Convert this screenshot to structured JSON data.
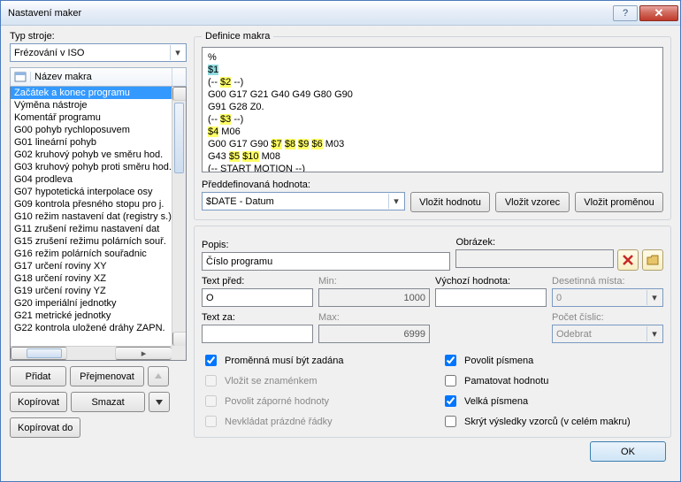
{
  "window": {
    "title": "Nastavení maker"
  },
  "left": {
    "machine_label": "Typ stroje:",
    "machine_value": "Frézování v ISO",
    "col_name": "Název makra",
    "items": [
      "Začátek a konec programu",
      "Výměna nástroje",
      "Komentář programu",
      "G00 pohyb rychloposuvem",
      "G01 lineární pohyb",
      "G02 kruhový pohyb ve směru hod.",
      "G03 kruhový pohyb proti směru hod.",
      "G04 prodleva",
      "G07 hypotetická interpolace osy",
      "G09 kontrola přesného stopu pro j.",
      "G10 režim nastavení dat (registry s.)",
      "G11 zrušení režimu nastavení dat",
      "G15 zrušení režimu polárních souř.",
      "G16 režim polárních souřadnic",
      "G17 určení roviny XY",
      "G18 určení roviny XZ",
      "G19 určení roviny YZ",
      "G20 imperiální jednotky",
      "G21 metrické jednotky",
      "G22 kontrola uložené dráhy ZAPN."
    ],
    "buttons": {
      "add": "Přidat",
      "rename": "Přejmenovat",
      "copy": "Kopírovat",
      "delete": "Smazat",
      "copy_to": "Kopírovat do"
    }
  },
  "right": {
    "def_legend": "Definice makra",
    "code_lines": [
      "%",
      {
        "hl": "cur",
        "text": "$1"
      },
      [
        "(-- ",
        {
          "hl": "y",
          "text": "$2"
        },
        " --)"
      ],
      "G00 G17 G21 G40 G49 G80 G90",
      "G91 G28 Z0.",
      [
        "(-- ",
        {
          "hl": "y",
          "text": "$3"
        },
        " --)"
      ],
      [
        {
          "hl": "y",
          "text": "$4"
        },
        " M06"
      ],
      [
        "G00 G17 G90 ",
        {
          "hl": "y",
          "text": "$7"
        },
        " ",
        {
          "hl": "y",
          "text": "$8"
        },
        " ",
        {
          "hl": "y",
          "text": "$9"
        },
        " ",
        {
          "hl": "y",
          "text": "$6"
        },
        " M03"
      ],
      [
        "G43 ",
        {
          "hl": "y",
          "text": "$5"
        },
        " ",
        {
          "hl": "y",
          "text": "$10"
        },
        " M08"
      ],
      "(-- START MOTION --)"
    ],
    "predef_label": "Předdefinovaná hodnota:",
    "predef_value": "$DATE - Datum",
    "btn_insert_val": "Vložit hodnotu",
    "btn_insert_pat": "Vložit vzorec",
    "btn_insert_var": "Vložit proměnou",
    "popis_label": "Popis:",
    "popis_value": "Číslo programu",
    "obrazek_label": "Obrázek:",
    "text_pred_label": "Text před:",
    "text_pred_value": "O",
    "min_label": "Min:",
    "min_value": "1000",
    "vychozi_label": "Výchozí hodnota:",
    "desetinna_label": "Desetinná místa:",
    "desetinna_value": "0",
    "text_za_label": "Text za:",
    "max_label": "Max:",
    "max_value": "6999",
    "pocet_label": "Počet číslic:",
    "pocet_value": "Odebrat",
    "checks": {
      "c1": "Proměnná musí být zadána",
      "c2": "Povolit písmena",
      "c3": "Vložit se znaménkem",
      "c4": "Pamatovat hodnotu",
      "c5": "Povolit záporné hodnoty",
      "c6": "Velká písmena",
      "c7": "Nevkládat prázdné řádky",
      "c8": "Skrýt výsledky vzorců (v celém makru)"
    },
    "ok": "OK"
  }
}
